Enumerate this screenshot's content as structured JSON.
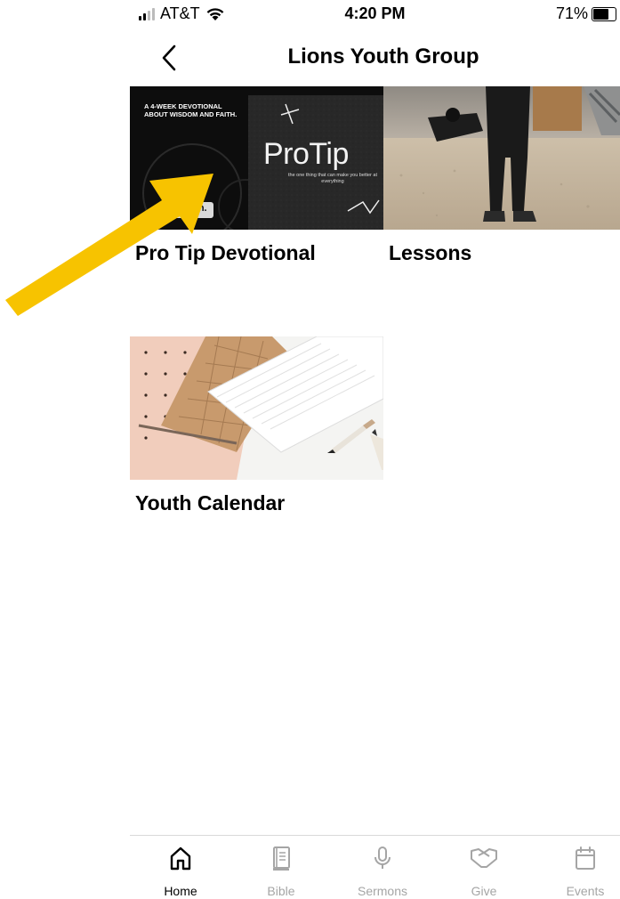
{
  "status_bar": {
    "carrier": "AT&T",
    "time": "4:20 PM",
    "battery": "71%",
    "battery_level": 0.71
  },
  "nav": {
    "title": "Lions Youth Group"
  },
  "tiles": [
    {
      "label": "Pro Tip Devotional",
      "image_text": {
        "tagline": "A 4-WEEK DEVOTIONAL ABOUT WISDOM AND FAITH.",
        "headline": "ProTip",
        "subline": "the one thing that can make you better at everything",
        "badge": "aith."
      }
    },
    {
      "label": "Lessons"
    },
    {
      "label": "Youth Calendar"
    }
  ],
  "tab_bar": {
    "tabs": [
      {
        "label": "Home",
        "icon": "home-icon",
        "active": true
      },
      {
        "label": "Bible",
        "icon": "bible-icon",
        "active": false
      },
      {
        "label": "Sermons",
        "icon": "microphone-icon",
        "active": false
      },
      {
        "label": "Give",
        "icon": "handshake-icon",
        "active": false
      },
      {
        "label": "Events",
        "icon": "calendar-icon",
        "active": false
      }
    ]
  },
  "colors": {
    "arrow": "#f7c300",
    "tab_inactive": "#a5a5a5",
    "tab_active": "#000000"
  }
}
